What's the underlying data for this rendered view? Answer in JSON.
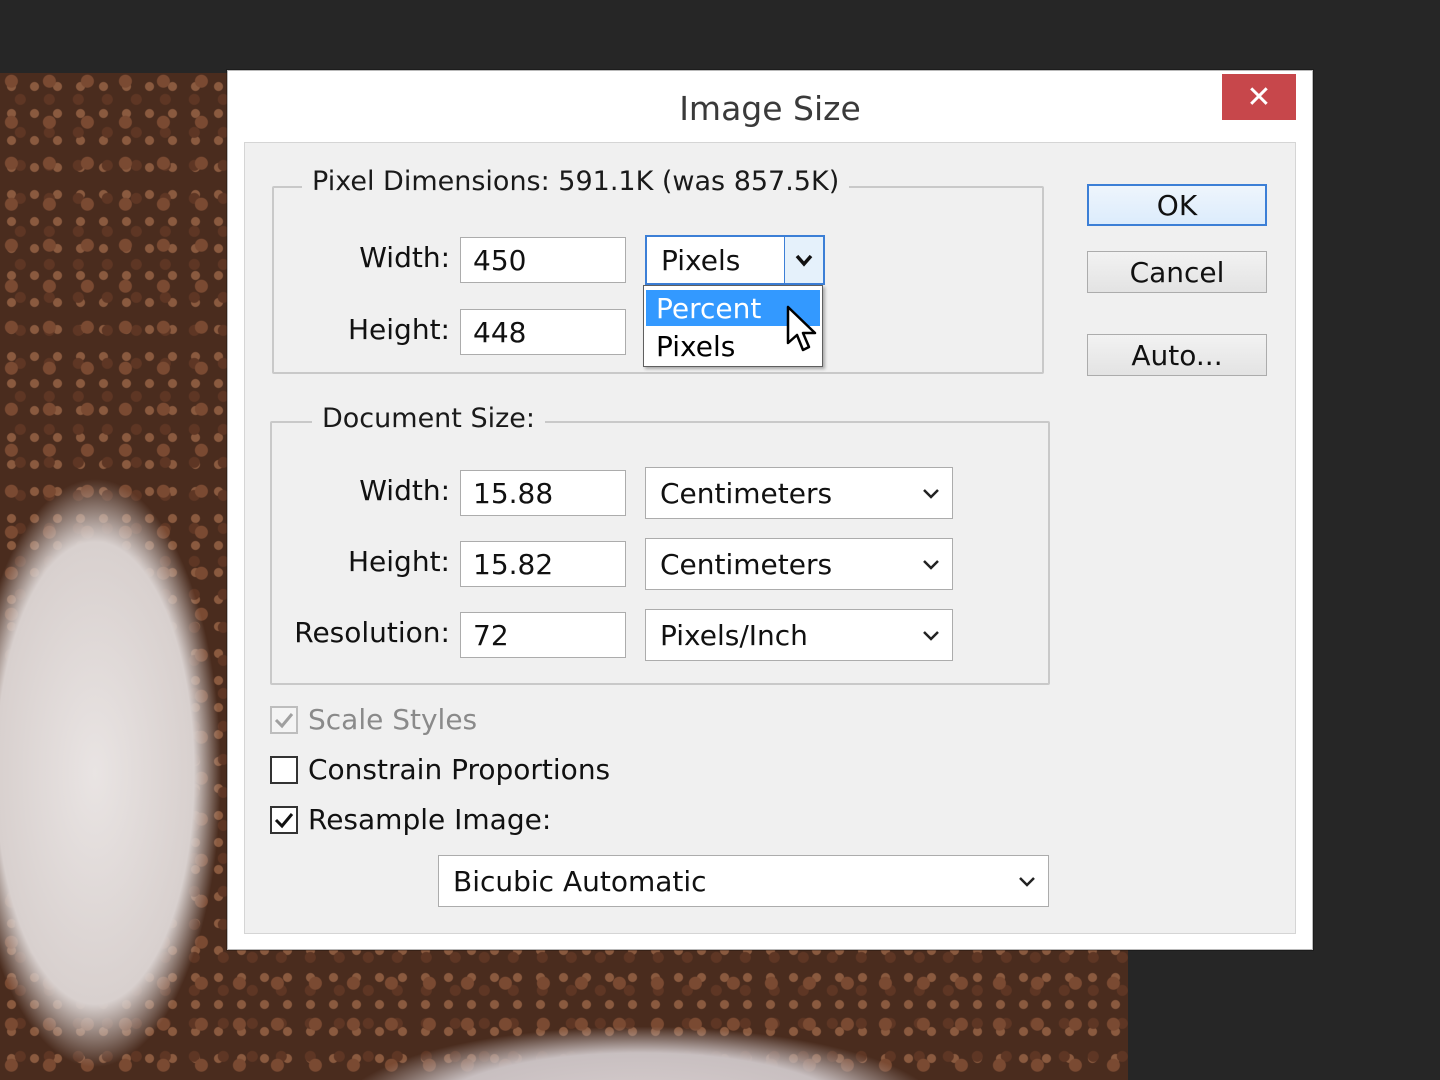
{
  "dialog": {
    "title": "Image Size",
    "close_glyph": "✕"
  },
  "pixel_dimensions": {
    "legend": "Pixel Dimensions:  591.1K (was 857.5K)",
    "width_label": "Width:",
    "width_value": "450",
    "width_unit": "Pixels",
    "height_label": "Height:",
    "height_value": "448",
    "unit_options": [
      "Percent",
      "Pixels"
    ],
    "highlighted_option": "Percent"
  },
  "document_size": {
    "legend": "Document Size:",
    "width_label": "Width:",
    "width_value": "15.88",
    "width_unit": "Centimeters",
    "height_label": "Height:",
    "height_value": "15.82",
    "height_unit": "Centimeters",
    "resolution_label": "Resolution:",
    "resolution_value": "72",
    "resolution_unit": "Pixels/Inch"
  },
  "options": {
    "scale_styles": {
      "label": "Scale Styles",
      "checked": true,
      "disabled": true
    },
    "constrain_proportions": {
      "label": "Constrain Proportions",
      "checked": false
    },
    "resample_image": {
      "label": "Resample Image:",
      "checked": true
    },
    "resample_method": "Bicubic Automatic"
  },
  "buttons": {
    "ok": "OK",
    "cancel": "Cancel",
    "auto": "Auto..."
  },
  "colors": {
    "accent": "#3399ff",
    "close": "#c7474b"
  }
}
